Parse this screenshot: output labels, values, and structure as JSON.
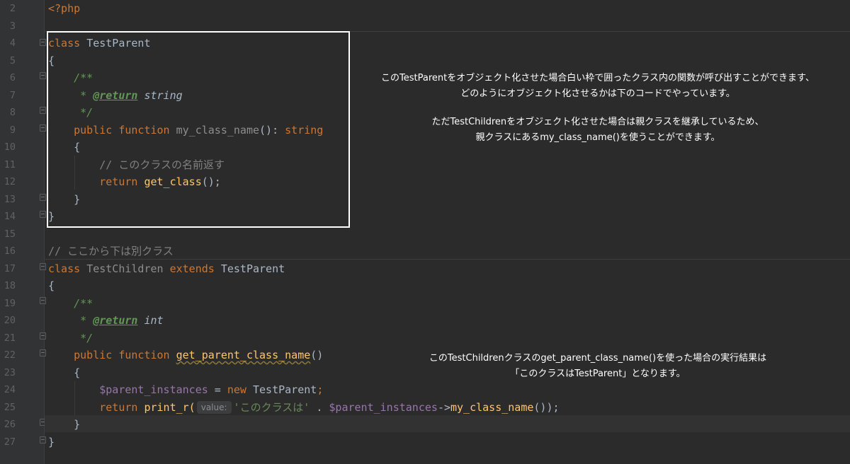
{
  "gutter": {
    "line_numbers": [
      "2",
      "3",
      "4",
      "5",
      "6",
      "7",
      "8",
      "9",
      "10",
      "11",
      "12",
      "13",
      "14",
      "15",
      "16",
      "17",
      "18",
      "19",
      "20",
      "21",
      "22",
      "23",
      "24",
      "25",
      "26",
      "27"
    ]
  },
  "code": {
    "open_tag": "<?php",
    "parent_class_keyword": "class",
    "parent_class_name": "TestParent",
    "brace_open": "{",
    "brace_close": "}",
    "doc_open": "/**",
    "doc_star": " * ",
    "doc_return_tag": "@return",
    "doc_return_type_string": "string",
    "doc_close": " */",
    "kw_public": "public",
    "kw_function": "function",
    "method_my_class_name": "my_class_name",
    "paren_pair": "()",
    "return_colon": ": ",
    "return_type": "string",
    "comment_class_name": "// このクラスの名前返す",
    "kw_return": "return",
    "call_get_class": "get_class",
    "call_get_class_suffix": "();",
    "comment_separator": "// ここから下は別クラス",
    "child_class_name": "TestChildren",
    "kw_extends": "extends",
    "extends_class_name": "TestParent",
    "doc_return_type_int": "int",
    "method_get_parent_class_name": "get_parent_class_name",
    "var_parent_instances": "$parent_instances",
    "assign_op": " = ",
    "kw_new": "new",
    "new_class_name": "TestParent",
    "semicolon": ";",
    "call_print_r": "print_r(",
    "param_hint": "value:",
    "string_literal": "'このクラスは'",
    "concat_op": " . ",
    "arrow_op": "->",
    "call_suffix": "());"
  },
  "annotations": {
    "parent_note_line1": "このTestParentをオブジェクト化させた場合白い枠で囲ったクラス内の関数が呼び出すことができます、",
    "parent_note_line2": "どのようにオブジェクト化させるかは下のコードでやっています。",
    "child_note_line1": "ただTestChildrenをオブジェクト化させた場合は親クラスを継承しているため、",
    "child_note_line2": "親クラスにあるmy_class_name()を使うことができます。",
    "result_note_line1": "このTestChildrenクラスのget_parent_class_name()を使った場合の実行結果は",
    "result_note_line2": "「このクラスはTestParent」となります。"
  },
  "colors": {
    "editor_bg": "#2b2b2b",
    "gutter_bg": "#313335",
    "keyword": "#cc7832",
    "function": "#ffc66d",
    "doc_comment": "#629755",
    "variable": "#9876aa",
    "string": "#6a8759",
    "comment": "#808080",
    "highlight_frame": "#ffffff"
  }
}
